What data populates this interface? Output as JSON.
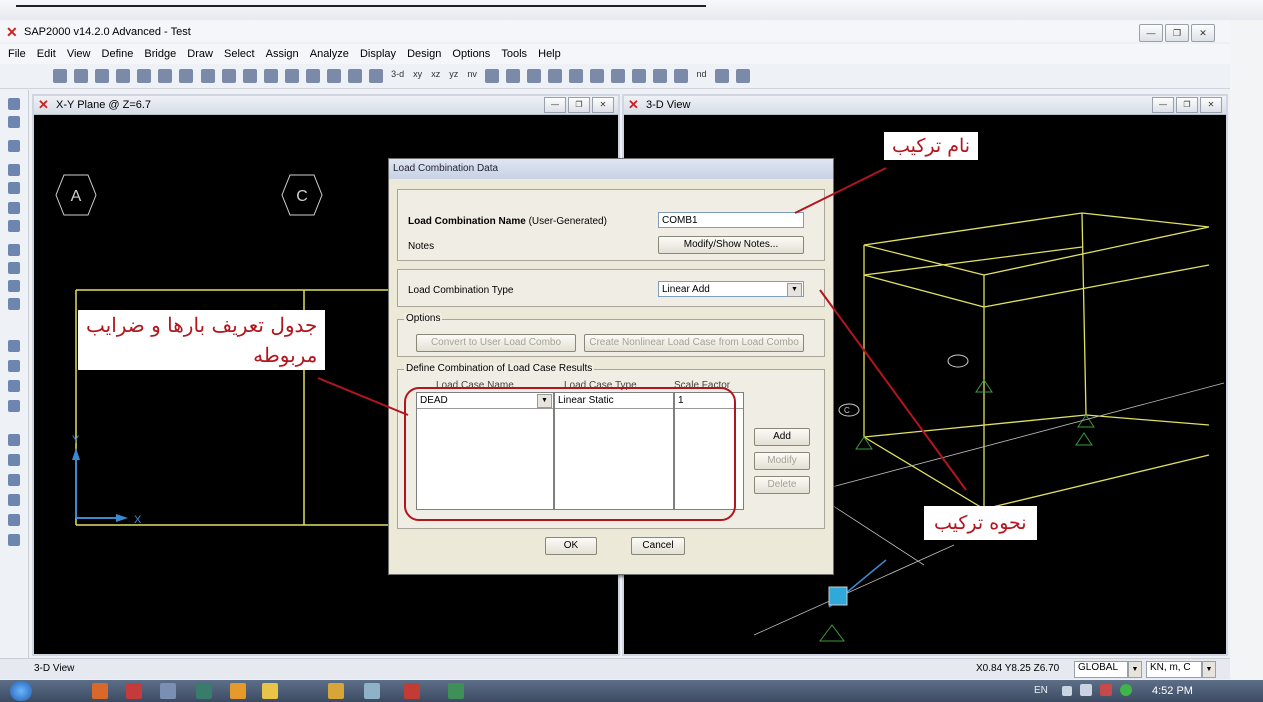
{
  "window": {
    "title": "SAP2000 v14.2.0 Advanced  - Test"
  },
  "menu": [
    "File",
    "Edit",
    "View",
    "Define",
    "Bridge",
    "Draw",
    "Select",
    "Assign",
    "Analyze",
    "Display",
    "Design",
    "Options",
    "Tools",
    "Help"
  ],
  "toolbar": {
    "view_labels": [
      "3-d",
      "xy",
      "xz",
      "yz",
      "nv"
    ],
    "nd_label": "nd"
  },
  "left_view": {
    "title": "X-Y Plane @ Z=6.7",
    "grid_bubbles": [
      "A",
      "C"
    ],
    "axis_x": "X",
    "axis_y": "Y"
  },
  "right_view": {
    "title": "3-D View",
    "grid_bubble": "C"
  },
  "dialog": {
    "title": "Load Combination Data",
    "name_label": "Load Combination Name",
    "name_note": "(User-Generated)",
    "name_value": "COMB1",
    "notes_label": "Notes",
    "notes_button": "Modify/Show Notes...",
    "type_label": "Load Combination Type",
    "type_value": "Linear Add",
    "options_legend": "Options",
    "convert_button": "Convert to User Load Combo",
    "create_button": "Create Nonlinear Load Case from Load Combo",
    "define_legend": "Define Combination of Load Case Results",
    "col_headers": [
      "Load Case Name",
      "Load Case Type",
      "Scale Factor"
    ],
    "row": {
      "case": "DEAD",
      "type": "Linear Static",
      "factor": "1"
    },
    "add_button": "Add",
    "modify_button": "Modify",
    "delete_button": "Delete",
    "ok_button": "OK",
    "cancel_button": "Cancel"
  },
  "annotations": {
    "name": "نام ترکیب",
    "table_line1": "جدول تعریف بارها و ضرایب",
    "table_line2": "مربوطه",
    "type": "نحوه ترکیب"
  },
  "status": {
    "view": "3-D View",
    "coords": "X0.84  Y8.25  Z6.70",
    "coord_system": "GLOBAL",
    "units": "KN, m, C"
  },
  "taskbar": {
    "lang": "EN",
    "time": "4:52 PM"
  },
  "colors": {
    "annotation": "#b2151d",
    "structure": "#e0e060",
    "viewport_bg": "#000000",
    "dialog_bg": "#ece9d8"
  }
}
